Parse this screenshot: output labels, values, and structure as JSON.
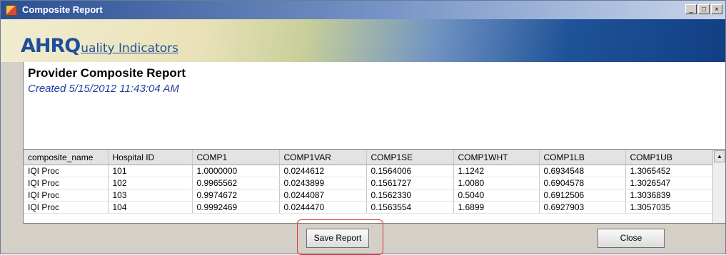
{
  "window": {
    "title": "Composite Report",
    "controls": [
      "_",
      "□",
      "×"
    ]
  },
  "banner": {
    "logo_main": "AHRQ",
    "logo_rest": "uality Indicators"
  },
  "report": {
    "title": "Provider Composite Report",
    "created": "Created 5/15/2012 11:43:04 AM"
  },
  "grid": {
    "columns": [
      "composite_name",
      "Hospital ID",
      "COMP1",
      "COMP1VAR",
      "COMP1SE",
      "COMP1WHT",
      "COMP1LB",
      "COMP1UB"
    ],
    "rows": [
      [
        "IQI Proc",
        "101",
        "1.0000000",
        "0.0244612",
        "0.1564006",
        "1.1242",
        "0.6934548",
        "1.3065452"
      ],
      [
        "IQI Proc",
        "102",
        "0.9965562",
        "0.0243899",
        "0.1561727",
        "1.0080",
        "0.6904578",
        "1.3026547"
      ],
      [
        "IQI Proc",
        "103",
        "0.9974672",
        "0.0244087",
        "0.1562330",
        "0.5040",
        "0.6912506",
        "1.3036839"
      ],
      [
        "IQI Proc",
        "104",
        "0.9992469",
        "0.0244470",
        "0.1563554",
        "1.6899",
        "0.6927903",
        "1.3057035"
      ]
    ]
  },
  "buttons": {
    "save": "Save Report",
    "close": "Close"
  },
  "icons": {
    "scroll_up": "▲"
  },
  "colors": {
    "highlight": "#e0352f",
    "created_text": "#1f3fa0",
    "logo": "#1f4e9c"
  }
}
